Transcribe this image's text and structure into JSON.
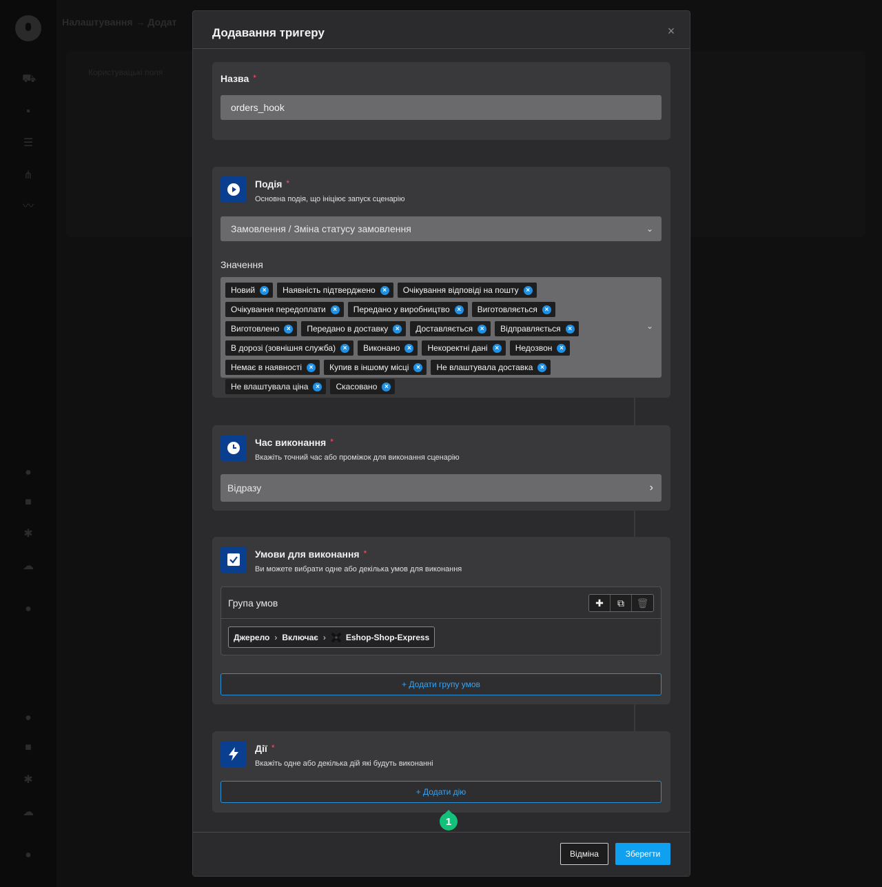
{
  "background": {
    "breadcrumb": "Налаштування  →  Додат",
    "subtitle": "Користувацькі поля"
  },
  "modal": {
    "title": "Додавання тригеру",
    "close_icon": "×",
    "name_section": {
      "label": "Назва",
      "required_mark": "*",
      "value": "orders_hook"
    },
    "event_section": {
      "title": "Подія",
      "required_mark": "*",
      "description": "Основна подія, що ініціює запуск сценарію",
      "selected_event": "Замовлення / Зміна статусу замовлення",
      "values_label": "Значення",
      "values": [
        "Новий",
        "Наявність підтверджено",
        "Очікування відповіді на пошту",
        "Очікування передоплати",
        "Передано у виробництво",
        "Виготовляється",
        "Виготовлено",
        "Передано в доставку",
        "Доставляється",
        "Відправляється",
        "В дорозі (зовнішня служба)",
        "Виконано",
        "Некоректні дані",
        "Недозвон",
        "Немає в наявності",
        "Купив в іншому місці",
        "Не влаштувала доставка",
        "Не влаштувала ціна",
        "Скасовано"
      ]
    },
    "time_section": {
      "title": "Час виконання",
      "required_mark": "*",
      "description": "Вкажіть точний час або проміжок для виконання сценарію",
      "value": "Відразу"
    },
    "conditions_section": {
      "title": "Умови для виконання",
      "required_mark": "*",
      "description": "Ви можете вибрати одне або декілька умов для виконання",
      "group_title": "Група умов",
      "condition": {
        "field": "Джерело",
        "operator": "Включає",
        "value": "Eshop-Shop-Express"
      },
      "add_group_label": "+ Додати групу умов"
    },
    "actions_section": {
      "title": "Дії",
      "required_mark": "*",
      "description": "Вкажіть одне або декілька дій які будуть виконанні",
      "add_action_label": "+ Додати дію",
      "badge_number": "1"
    },
    "footer": {
      "cancel_label": "Відміна",
      "save_label": "Зберегти"
    }
  },
  "colors": {
    "accent": "#0fa0f0",
    "icon_bg": "#0a3f8f",
    "required": "#ff4d6a",
    "badge": "#13c07a"
  }
}
